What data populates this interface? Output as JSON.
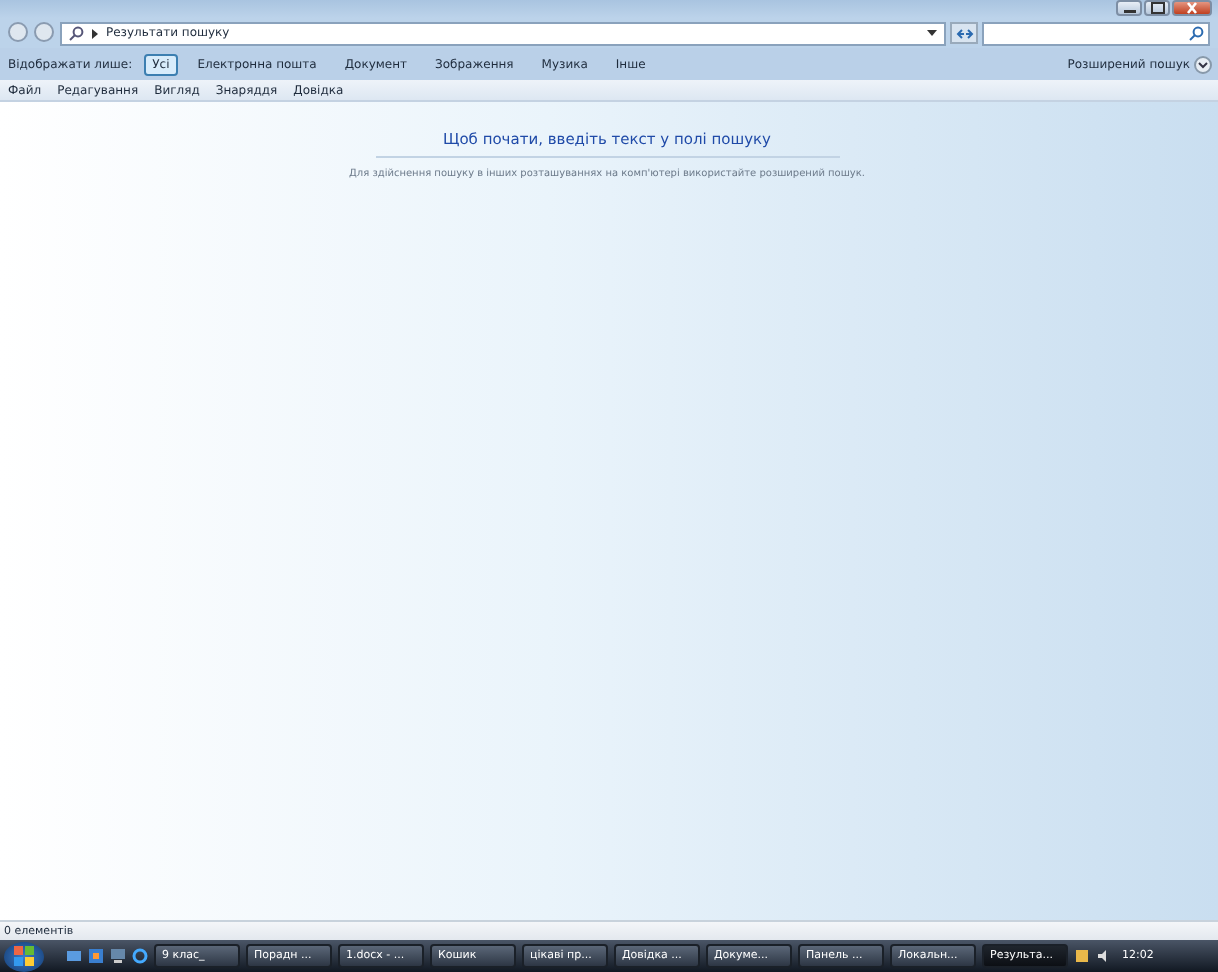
{
  "address_bar": {
    "path": "Результати пошуку"
  },
  "filter_bar": {
    "label": "Відображати лише:",
    "filters": [
      {
        "label": "Усі",
        "selected": true
      },
      {
        "label": "Електронна пошта",
        "selected": false
      },
      {
        "label": "Документ",
        "selected": false
      },
      {
        "label": "Зображення",
        "selected": false
      },
      {
        "label": "Музика",
        "selected": false
      },
      {
        "label": "Інше",
        "selected": false
      }
    ],
    "advanced": "Розширений пошук"
  },
  "menu": [
    "Файл",
    "Редагування",
    "Вигляд",
    "Знаряддя",
    "Довідка"
  ],
  "content": {
    "heading": "Щоб почати, введіть текст у полі пошуку",
    "hint": "Для здійснення пошуку в інших розташуваннях на комп'ютері використайте розширений пошук."
  },
  "status_bar": {
    "text": "0 елементів"
  },
  "taskbar": {
    "items": [
      {
        "label": "9 клас_",
        "selected": false
      },
      {
        "label": "Порадн ...",
        "selected": false
      },
      {
        "label": "1.docx - ...",
        "selected": false
      },
      {
        "label": "Кошик",
        "selected": false
      },
      {
        "label": "цікаві пр...",
        "selected": false
      },
      {
        "label": "Довідка ...",
        "selected": false
      },
      {
        "label": "Докуме...",
        "selected": false
      },
      {
        "label": "Панель ...",
        "selected": false
      },
      {
        "label": "Локальн...",
        "selected": false
      },
      {
        "label": "Результа...",
        "selected": true
      }
    ],
    "clock": "12:02"
  }
}
